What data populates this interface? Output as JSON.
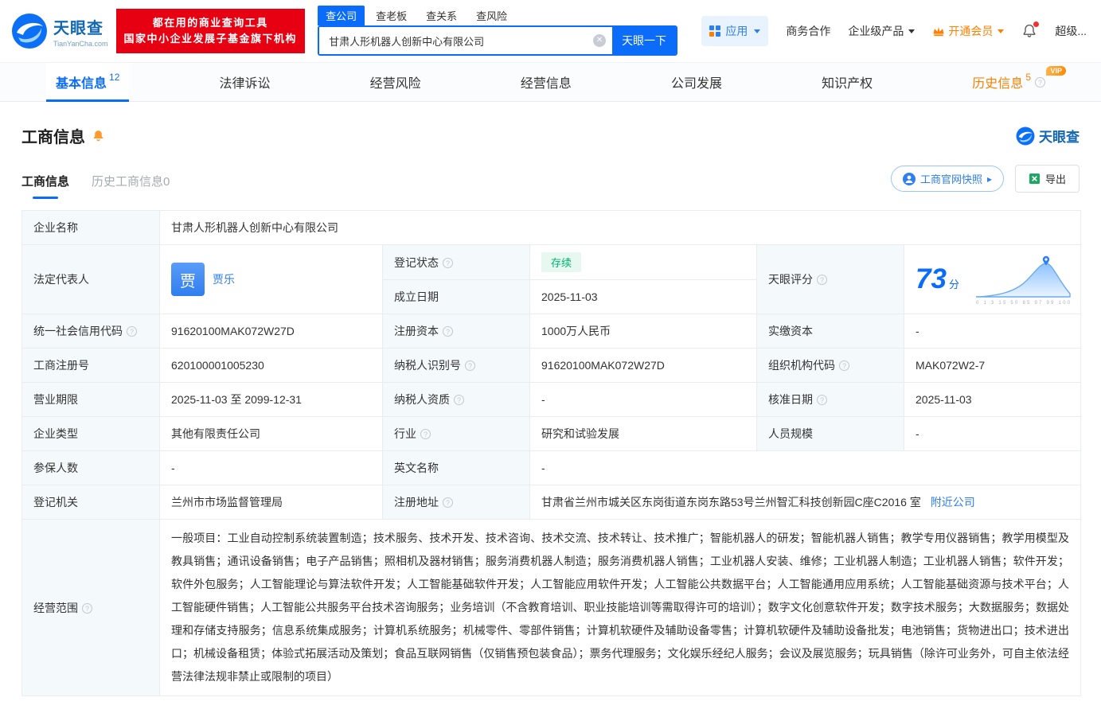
{
  "brand": {
    "name": "天眼查",
    "domain": "TianYanCha.com"
  },
  "promo": {
    "line1": "都在用的商业查询工具",
    "line2": "国家中小企业发展子基金旗下机构"
  },
  "search": {
    "tabs": [
      {
        "label": "查公司",
        "active": true
      },
      {
        "label": "查老板"
      },
      {
        "label": "查关系"
      },
      {
        "label": "查风险"
      }
    ],
    "value": "甘肃人形机器人创新中心有限公司",
    "button": "天眼一下"
  },
  "topnav": {
    "apps": "应用",
    "biz_coop": "商务合作",
    "enterprise": "企业级产品",
    "vip": "开通会员",
    "super": "超级..."
  },
  "tabs": {
    "vip_tag": "VIP",
    "items": [
      {
        "label": "基本信息",
        "count": "12"
      },
      {
        "label": "法律诉讼"
      },
      {
        "label": "经营风险"
      },
      {
        "label": "经营信息"
      },
      {
        "label": "公司发展"
      },
      {
        "label": "知识产权"
      },
      {
        "label": "历史信息",
        "count": "5"
      }
    ]
  },
  "section": {
    "title": "工商信息",
    "brand": "天眼查",
    "subtabs": [
      {
        "label": "工商信息",
        "active": true
      },
      {
        "label": "历史工商信息0"
      }
    ],
    "snapshot_button": "工商官网快照",
    "export_button": "导出"
  },
  "score_chart": {
    "ticks": "0 1 3 15 50 85 97 99 100"
  },
  "fields": {
    "company_name": {
      "label": "企业名称",
      "value": "甘肃人形机器人创新中心有限公司"
    },
    "legal_rep": {
      "label": "法定代表人",
      "avatar": "贾",
      "name": "贾乐"
    },
    "reg_status": {
      "label": "登记状态",
      "value": "存续"
    },
    "establish_date": {
      "label": "成立日期",
      "value": "2025-11-03"
    },
    "score": {
      "label": "天眼评分",
      "value": "73",
      "unit": "分"
    },
    "credit_code": {
      "label": "统一社会信用代码",
      "value": "91620100MAK072W27D"
    },
    "reg_capital": {
      "label": "注册资本",
      "value": "1000万人民币"
    },
    "paid_capital": {
      "label": "实缴资本",
      "value": "-"
    },
    "reg_number": {
      "label": "工商注册号",
      "value": "620100001005230"
    },
    "taxpayer_id": {
      "label": "纳税人识别号",
      "value": "91620100MAK072W27D"
    },
    "org_code": {
      "label": "组织机构代码",
      "value": "MAK072W2-7"
    },
    "business_term": {
      "label": "营业期限",
      "value": "2025-11-03 至 2099-12-31"
    },
    "taxpayer_quality": {
      "label": "纳税人资质",
      "value": "-"
    },
    "approval_date": {
      "label": "核准日期",
      "value": "2025-11-03"
    },
    "company_type": {
      "label": "企业类型",
      "value": "其他有限责任公司"
    },
    "industry": {
      "label": "行业",
      "value": "研究和试验发展"
    },
    "staff_size": {
      "label": "人员规模",
      "value": "-"
    },
    "insured_count": {
      "label": "参保人数",
      "value": "-"
    },
    "english_name": {
      "label": "英文名称",
      "value": "-"
    },
    "reg_authority": {
      "label": "登记机关",
      "value": "兰州市市场监督管理局"
    },
    "reg_address": {
      "label": "注册地址",
      "value": "甘肃省兰州市城关区东岗街道东岗东路53号兰州智汇科技创新园C座C2016 室",
      "link": "附近公司"
    },
    "business_scope": {
      "label": "经营范围",
      "value": "一般项目：工业自动控制系统装置制造；技术服务、技术开发、技术咨询、技术交流、技术转让、技术推广；智能机器人的研发；智能机器人销售；教学专用仪器销售；教学用模型及教具销售；通讯设备销售；电子产品销售；照相机及器材销售；服务消费机器人制造；服务消费机器人销售；工业机器人安装、维修；工业机器人制造；工业机器人销售；软件开发；软件外包服务；人工智能理论与算法软件开发；人工智能基础软件开发；人工智能应用软件开发；人工智能公共数据平台；人工智能通用应用系统；人工智能基础资源与技术平台；人工智能硬件销售；人工智能公共服务平台技术咨询服务；业务培训（不含教育培训、职业技能培训等需取得许可的培训）；数字文化创意软件开发；数字技术服务；大数据服务；数据处理和存储支持服务；信息系统集成服务；计算机系统服务；机械零件、零部件销售；计算机软硬件及辅助设备零售；计算机软硬件及辅助设备批发；电池销售；货物进出口；技术进出口；机械设备租赁；体验式拓展活动及策划；食品互联网销售（仅销售预包装食品）；票务代理服务；文化娱乐经纪人服务；会议及展览服务；玩具销售（除许可业务外，可自主依法经营法律法规非禁止或限制的项目）"
    }
  },
  "colors": {
    "accent": "#0b6cfa",
    "brand_red": "#e60012",
    "status_green": "#00b374",
    "vip_orange": "#ff8000"
  }
}
